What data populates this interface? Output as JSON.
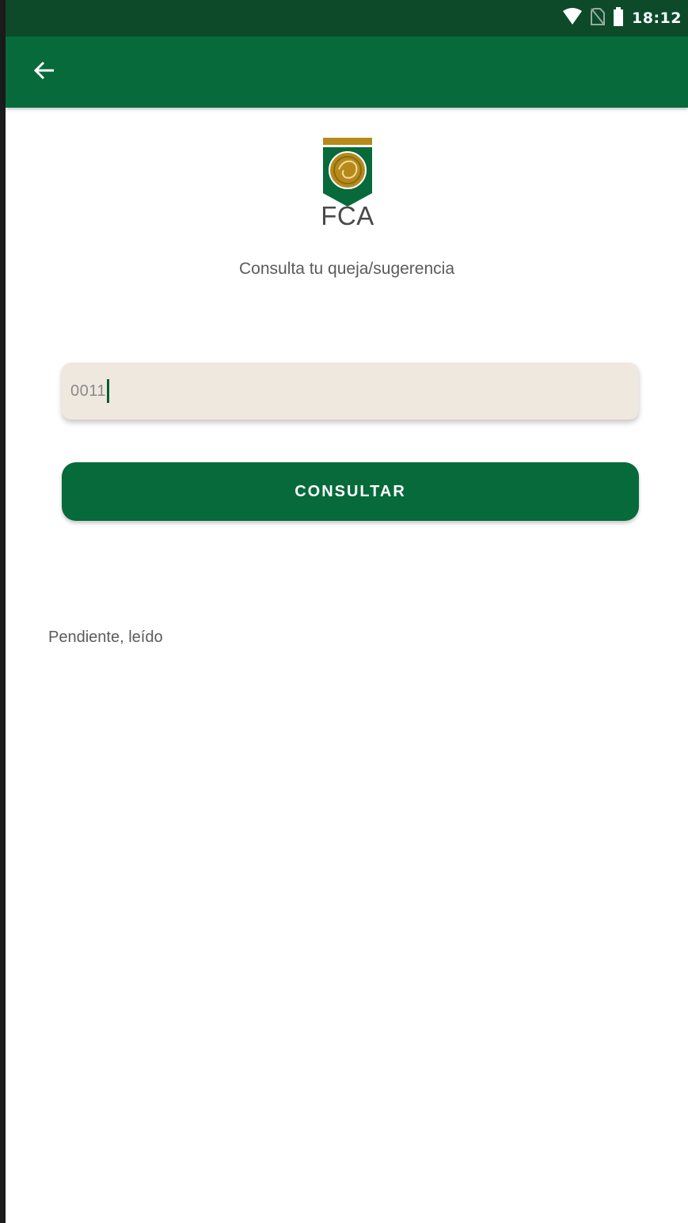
{
  "status_bar": {
    "time": "18:12",
    "icons": [
      "wifi-icon",
      "no-sim-icon",
      "battery-icon"
    ]
  },
  "app_bar": {
    "back_icon": "arrow-back-icon"
  },
  "logo": {
    "text": "FCA",
    "colors": {
      "green": "#066a3b",
      "gold": "#b58a1a"
    }
  },
  "form": {
    "subtitle": "Consulta tu queja/sugerencia",
    "input_value": "0011",
    "button_label": "CONSULTAR"
  },
  "result": {
    "status_text": "Pendiente, leído"
  },
  "colors": {
    "primary": "#066a3b",
    "status_bar": "#0c4a2a",
    "input_background": "#efe8df"
  }
}
